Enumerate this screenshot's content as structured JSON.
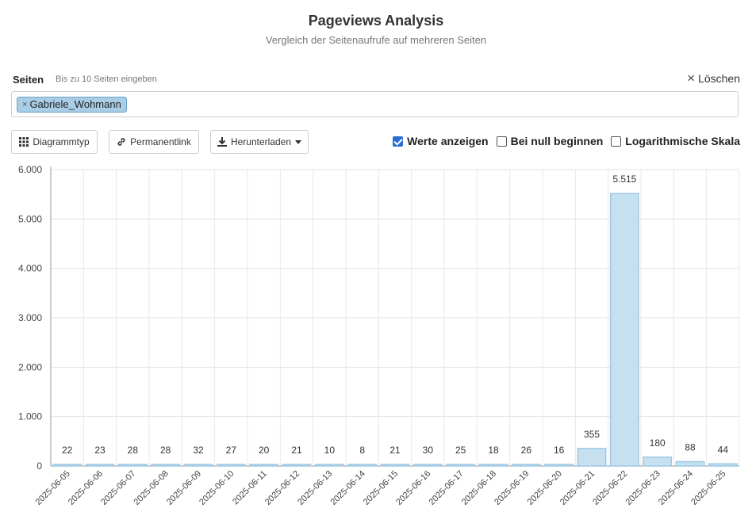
{
  "header": {
    "title": "Pageviews Analysis",
    "subtitle": "Vergleich der Seitenaufrufe auf mehreren Seiten"
  },
  "pages_field": {
    "label": "Seiten",
    "hint": "Bis zu 10 Seiten eingeben",
    "clear_label": "Löschen",
    "selected": [
      "Gabriele_Wohmann"
    ]
  },
  "toolbar": {
    "chart_type_label": "Diagrammtyp",
    "permalink_label": "Permanentlink",
    "download_label": "Herunterladen"
  },
  "options": {
    "show_values": {
      "label": "Werte anzeigen",
      "checked": true
    },
    "begin_at_zero": {
      "label": "Bei null beginnen",
      "checked": false
    },
    "log_scale": {
      "label": "Logarithmische Skala",
      "checked": false
    }
  },
  "colors": {
    "bar_fill": "#c7e0f0",
    "bar_stroke": "#9ec8e3",
    "tag_bg": "#a9cde6",
    "accent": "#2a6fcf"
  },
  "chart_data": {
    "type": "bar",
    "categories": [
      "2025-06-05",
      "2025-06-06",
      "2025-06-07",
      "2025-06-08",
      "2025-06-09",
      "2025-06-10",
      "2025-06-11",
      "2025-06-12",
      "2025-06-13",
      "2025-06-14",
      "2025-06-15",
      "2025-06-16",
      "2025-06-17",
      "2025-06-18",
      "2025-06-19",
      "2025-06-20",
      "2025-06-21",
      "2025-06-22",
      "2025-06-23",
      "2025-06-24",
      "2025-06-25"
    ],
    "series": [
      {
        "name": "Gabriele_Wohmann",
        "values": [
          22,
          23,
          28,
          28,
          32,
          27,
          20,
          21,
          10,
          8,
          21,
          30,
          25,
          18,
          26,
          16,
          355,
          5515,
          180,
          88,
          44
        ]
      }
    ],
    "value_labels": [
      "22",
      "23",
      "28",
      "28",
      "32",
      "27",
      "20",
      "21",
      "10",
      "8",
      "21",
      "30",
      "25",
      "18",
      "26",
      "16",
      "355",
      "5.515",
      "180",
      "88",
      "44"
    ],
    "y_ticks": [
      "0",
      "1.000",
      "2.000",
      "3.000",
      "4.000",
      "5.000",
      "6.000"
    ],
    "ylim": [
      0,
      6000
    ],
    "grid": true
  }
}
